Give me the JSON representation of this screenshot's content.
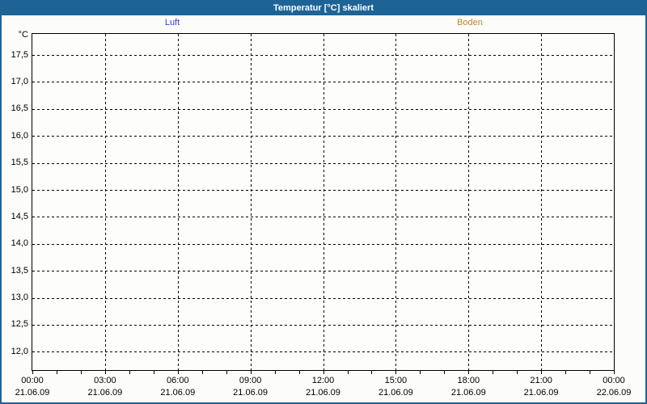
{
  "window": {
    "title": "Temperatur [°C] skaliert",
    "titlebar_color": "#1e6396",
    "border_color": "#1e6396",
    "background_color": "#fcfdfa"
  },
  "chart_data": {
    "type": "line",
    "title": "Temperatur [°C] skaliert",
    "xlabel": "",
    "ylabel": "°C",
    "ylim": [
      11.66,
      17.89
    ],
    "grid": "dashed",
    "legend_position": "top",
    "y_ticks": [
      {
        "value": 17.5,
        "label": "17,5"
      },
      {
        "value": 17.0,
        "label": "17,0"
      },
      {
        "value": 16.5,
        "label": "16,5"
      },
      {
        "value": 16.0,
        "label": "16,0"
      },
      {
        "value": 15.5,
        "label": "15,5"
      },
      {
        "value": 15.0,
        "label": "15,0"
      },
      {
        "value": 14.5,
        "label": "14,5"
      },
      {
        "value": 14.0,
        "label": "14,0"
      },
      {
        "value": 13.5,
        "label": "13,5"
      },
      {
        "value": 13.0,
        "label": "13,0"
      },
      {
        "value": 12.5,
        "label": "12,5"
      },
      {
        "value": 12.0,
        "label": "12,0"
      }
    ],
    "x_major_ticks": [
      {
        "time": "00:00",
        "date": "21.06.09"
      },
      {
        "time": "03:00",
        "date": "21.06.09"
      },
      {
        "time": "06:00",
        "date": "21.06.09"
      },
      {
        "time": "09:00",
        "date": "21.06.09"
      },
      {
        "time": "12:00",
        "date": "21.06.09"
      },
      {
        "time": "15:00",
        "date": "21.06.09"
      },
      {
        "time": "18:00",
        "date": "21.06.09"
      },
      {
        "time": "21:00",
        "date": "21.06.09"
      },
      {
        "time": "00:00",
        "date": "22.06.09"
      }
    ],
    "x_minor_per_major": 3,
    "series": [
      {
        "name": "Luft",
        "color": "#3a3ad0",
        "values": []
      },
      {
        "name": "Boden",
        "color": "#b8862f",
        "values": []
      }
    ]
  }
}
